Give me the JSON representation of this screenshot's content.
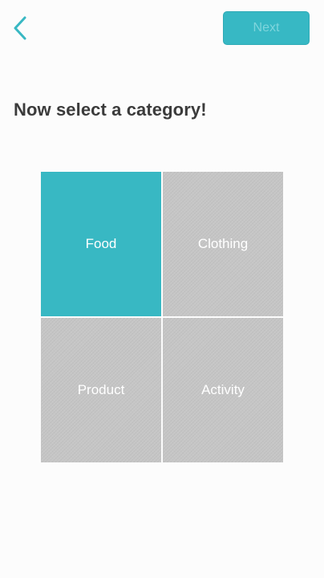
{
  "header": {
    "back_icon": "chevron-left-icon",
    "next_label": "Next"
  },
  "colors": {
    "accent": "#38b8c3",
    "tile_inactive": "#c6c6c6",
    "title_text": "#3b3b3b"
  },
  "title": "Now select a category!",
  "categories": [
    {
      "label": "Food",
      "selected": true
    },
    {
      "label": "Clothing",
      "selected": false
    },
    {
      "label": "Product",
      "selected": false
    },
    {
      "label": "Activity",
      "selected": false
    }
  ]
}
